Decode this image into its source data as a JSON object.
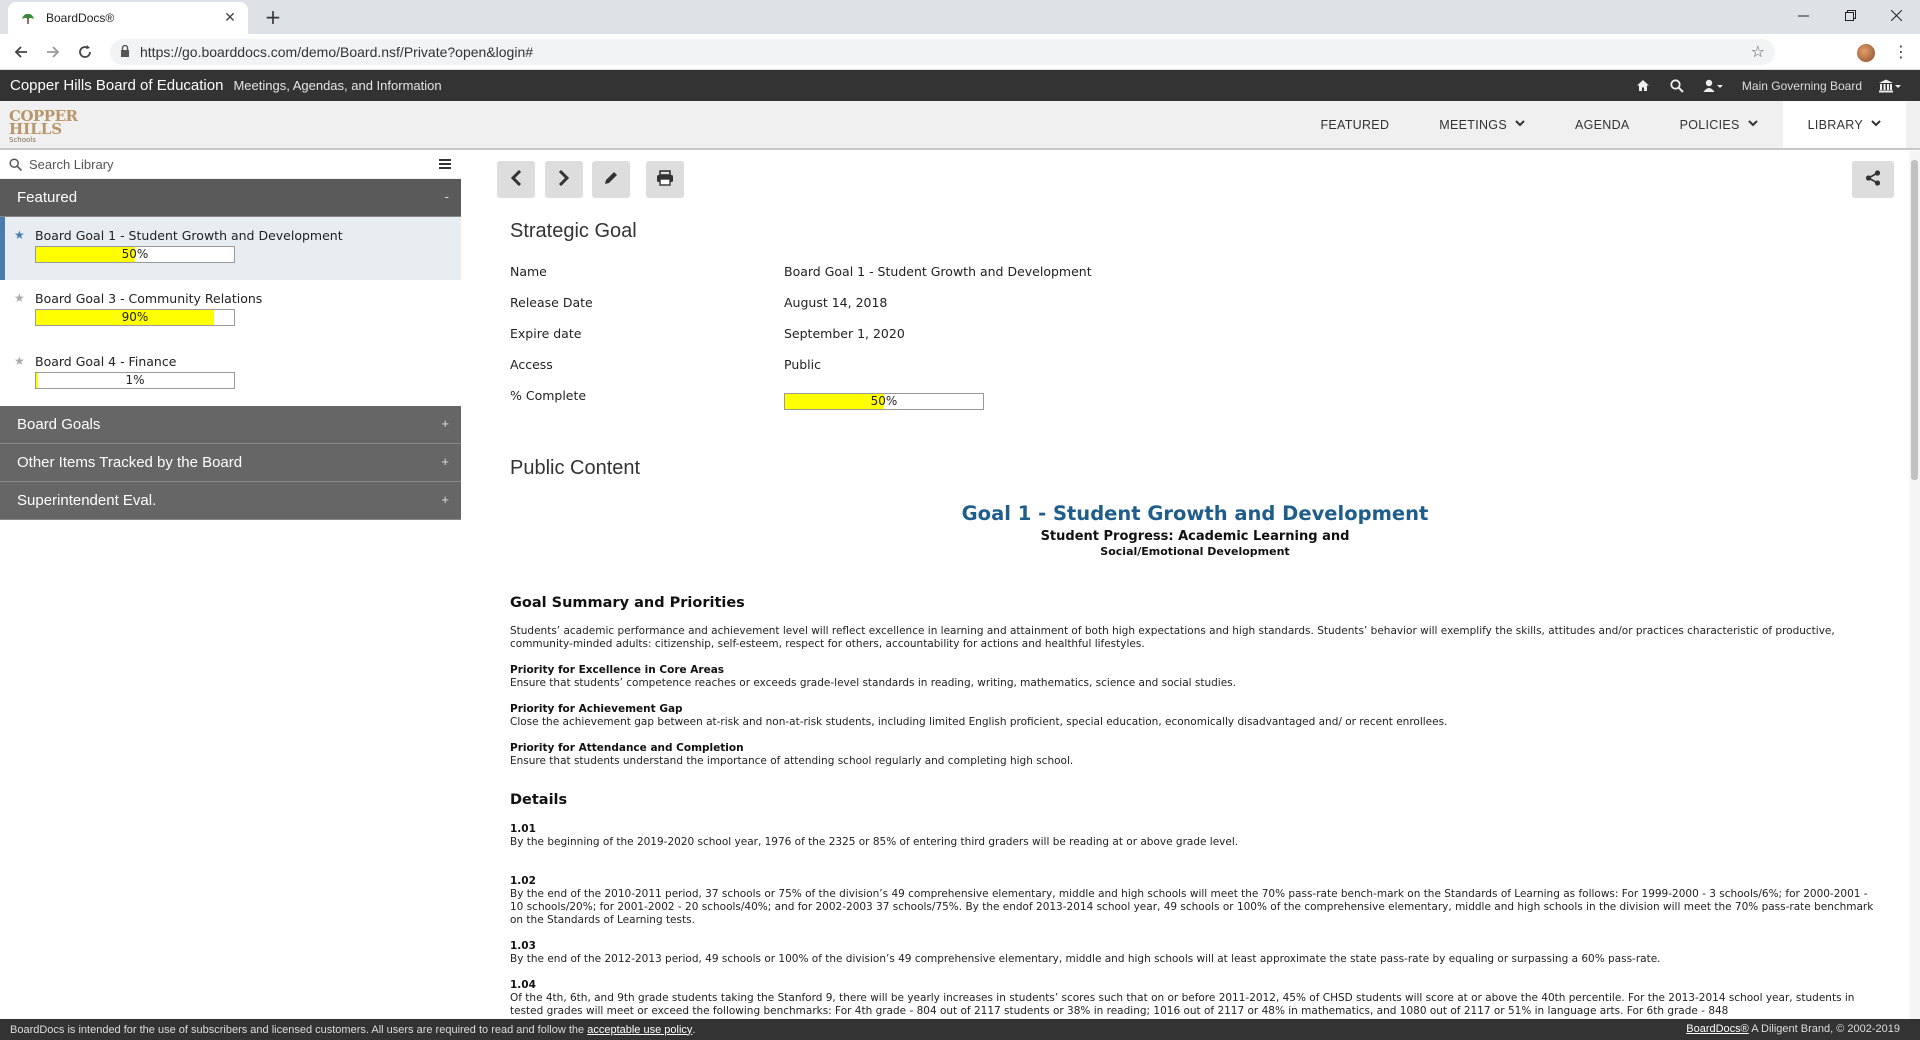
{
  "browser": {
    "tab_title": "BoardDocs®",
    "tab_close": "✕",
    "new_tab": "+",
    "url": "https://go.boarddocs.com/demo/Board.nsf/Private?open&login#"
  },
  "header": {
    "org_name": "Copper Hills Board of Education",
    "subtitle": "Meetings, Agendas, and Information",
    "board_selector": "Main Governing Board"
  },
  "logo": {
    "line1": "COPPER",
    "line2": "HILLS",
    "line3": "Schools"
  },
  "nav": {
    "featured": "FEATURED",
    "meetings": "MEETINGS",
    "agenda": "AGENDA",
    "policies": "POLICIES",
    "library": "LIBRARY"
  },
  "sidebar": {
    "search_placeholder": "Search Library",
    "featured_header": "Featured",
    "featured_toggle": "-",
    "goals": [
      {
        "name": "Board Goal 1 - Student Growth and Development",
        "progress": 50,
        "label": "50%",
        "selected": true
      },
      {
        "name": "Board Goal 3 - Community Relations",
        "progress": 90,
        "label": "90%",
        "selected": false
      },
      {
        "name": "Board Goal 4 - Finance",
        "progress": 1,
        "label": "1%",
        "selected": false
      }
    ],
    "sections": [
      {
        "label": "Board Goals",
        "toggle": "+"
      },
      {
        "label": "Other Items Tracked by the Board",
        "toggle": "+"
      },
      {
        "label": "Superintendent Eval.",
        "toggle": "+"
      }
    ]
  },
  "detail": {
    "heading": "Strategic Goal",
    "rows": [
      {
        "key": "Name",
        "value": "Board Goal 1 - Student Growth and Development"
      },
      {
        "key": "Release Date",
        "value": "August 14, 2018"
      },
      {
        "key": "Expire date",
        "value": "September 1, 2020"
      },
      {
        "key": "Access",
        "value": "Public"
      },
      {
        "key": "% Complete",
        "value": "50%",
        "progress": 50
      }
    ],
    "public_content_heading": "Public Content"
  },
  "document": {
    "title": "Goal 1 - Student Growth and Development",
    "subtitle1": "Student Progress: Academic Learning and",
    "subtitle2": "Social/Emotional Development",
    "summary_heading": "Goal Summary and Priorities",
    "summary_text": "Students’ academic performance and achievement level will reflect excellence in learning and attainment of both high expectations and high standards. Students’ behavior will exemplify the skills, attitudes and/or practices characteristic of productive, community-minded adults: citizenship, self-esteem, respect for others, accountability for actions and healthful lifestyles.",
    "priorities": [
      {
        "title": "Priority for Excellence in Core Areas",
        "text": "Ensure that students’ competence reaches or exceeds grade-level standards in reading, writing, mathematics, science and social studies."
      },
      {
        "title": "Priority for Achievement Gap",
        "text": "Close the achievement gap between at-risk and non-at-risk students, including limited English proficient, special education, economically disadvantaged and/ or recent enrollees."
      },
      {
        "title": "Priority for Attendance and Completion",
        "text": "Ensure that students understand the importance of attending school regularly and completing high school."
      }
    ],
    "details_heading": "Details",
    "details": [
      {
        "num": "1.01",
        "text": "By the beginning of the 2019-2020 school year, 1976 of the 2325 or 85% of entering third graders will be reading at or above grade level."
      },
      {
        "num": "1.02",
        "text": "By the end of the 2010-2011 period, 37 schools or 75% of the division’s 49 comprehensive elementary, middle and high schools will meet the 70% pass-rate bench-mark on the Standards of Learning as follows: For 1999-2000 - 3 schools/6%; for 2000-2001 - 10 schools/20%; for 2001-2002 - 20 schools/40%; and for 2002-2003 37 schools/75%. By the endof 2013-2014 school year, 49 schools or 100% of the comprehensive elementary, middle and high schools in the division will meet the 70% pass-rate benchmark on the Standards of Learning tests."
      },
      {
        "num": "1.03",
        "text": "By the end of the 2012-2013 period, 49 schools or 100% of the division’s 49 comprehensive elementary, middle and high schools will at least approximate the state pass-rate by equaling or surpassing a 60% pass-rate."
      },
      {
        "num": "1.04",
        "text": "Of the 4th, 6th, and 9th grade students taking the Stanford 9, there will be yearly increases in students’ scores such that on or before 2011-2012, 45% of CHSD students will score at or above the 40th percentile. For the 2013-2014 school year, students in tested grades will meet or exceed the following benchmarks: For 4th grade - 804 out of 2117 students or 38% in reading; 1016 out of 2117 or 48% in mathematics, and 1080 out of 2117 or 51% in language arts. For 6th grade - 848"
      }
    ]
  },
  "footer": {
    "notice": "BoardDocs is intended for the use of subscribers and licensed customers. All users are required to read and follow the",
    "link": "acceptable use policy",
    "period": ".",
    "brand_link": "BoardDocs®",
    "brand_rest": " A Diligent Brand, © 2002-2019"
  }
}
